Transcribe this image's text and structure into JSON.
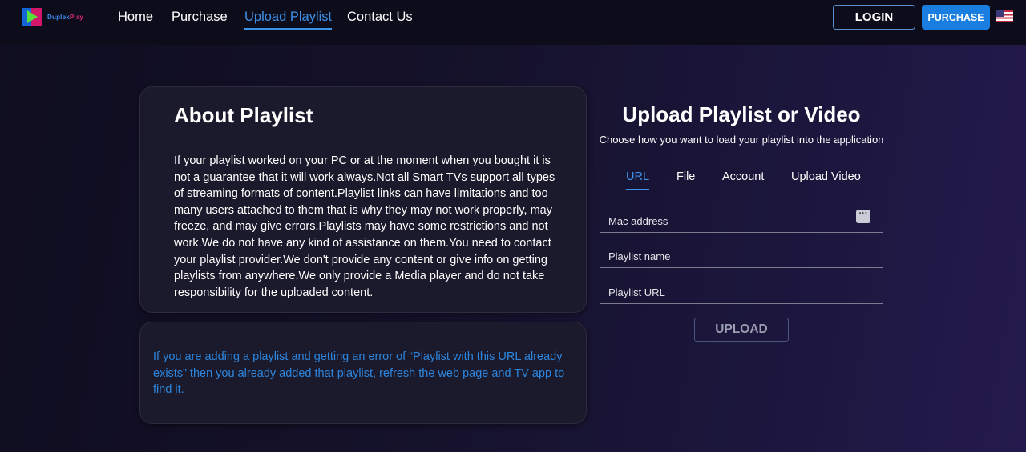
{
  "header": {
    "logo": {
      "part1": "Duplex",
      "part2": "Play"
    },
    "nav": [
      {
        "label": "Home",
        "active": false
      },
      {
        "label": "Purchase",
        "active": false
      },
      {
        "label": "Upload Playlist",
        "active": true
      },
      {
        "label": "Contact Us",
        "active": false
      }
    ],
    "login_label": "LOGIN",
    "purchase_label": "PURCHASE",
    "language_flag_icon": "us-flag-icon"
  },
  "about": {
    "title": "About Playlist",
    "body": "If your playlist worked on your PC or at the moment when you bought it is not a guarantee that it will work always.Not all Smart TVs support all types of streaming formats of content.Playlist links can have limitations and too many users attached to them that is why they may not work properly, may freeze, and may give errors.Playlists may have some restrictions and not work.We do not have any kind of assistance on them.You need to contact your playlist provider.We don't provide any content or give info on getting playlists from anywhere.We only provide a Media player and do not take responsibility for the uploaded content."
  },
  "note": {
    "text": "If you are adding a playlist and getting an error of “Playlist with this URL already exists” then you already added that playlist, refresh the web page and TV app to find it."
  },
  "form": {
    "title": "Upload Playlist or Video",
    "subtitle": "Choose how you want to load your playlist into the application",
    "tabs": [
      {
        "label": "URL",
        "active": true
      },
      {
        "label": "File",
        "active": false
      },
      {
        "label": "Account",
        "active": false
      },
      {
        "label": "Upload Video",
        "active": false
      }
    ],
    "fields": {
      "mac": {
        "placeholder": "Mac address",
        "value": ""
      },
      "name": {
        "placeholder": "Playlist name",
        "value": ""
      },
      "url": {
        "placeholder": "Playlist URL",
        "value": ""
      }
    },
    "upload_label": "UPLOAD"
  },
  "colors": {
    "accent": "#3d92e8",
    "purchase_button": "#1a7ee0",
    "note_text": "#2d86de",
    "card_bg": "#1b1a2c"
  }
}
